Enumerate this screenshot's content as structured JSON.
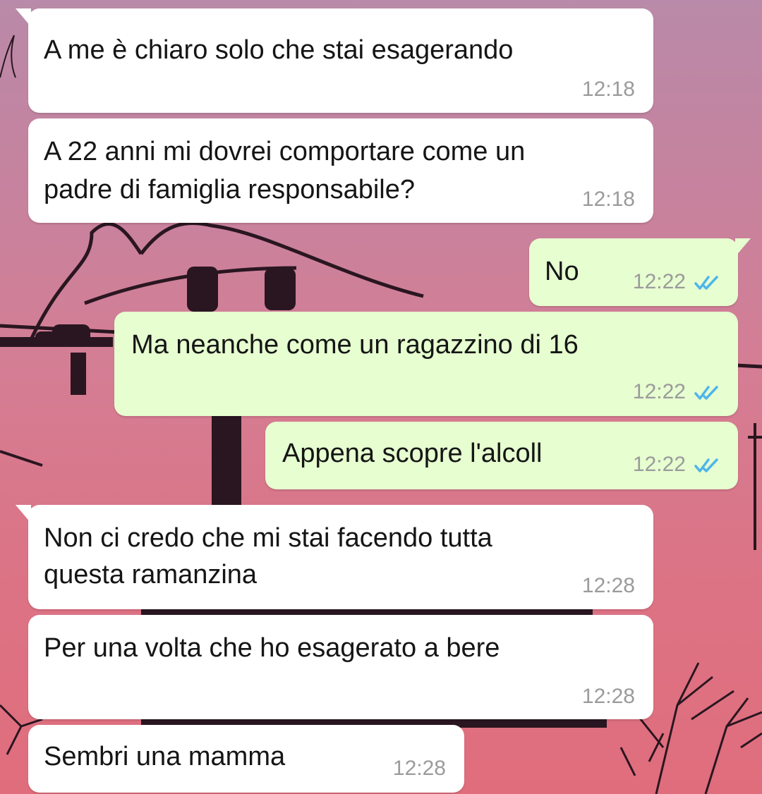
{
  "chat": {
    "messages": [
      {
        "dir": "in",
        "text": "A me è chiaro solo che stai esagerando",
        "time": "12:18"
      },
      {
        "dir": "in",
        "text_lines": [
          "A 22 anni mi dovrei comportare come un",
          "padre di famiglia responsabile?"
        ],
        "time": "12:18"
      },
      {
        "dir": "out",
        "text": "No",
        "time": "12:22",
        "status": "read"
      },
      {
        "dir": "out",
        "text": "Ma neanche come un ragazzino di 16",
        "time": "12:22",
        "status": "read"
      },
      {
        "dir": "out",
        "text": "Appena scopre l'alcoll",
        "time": "12:22",
        "status": "read"
      },
      {
        "dir": "in",
        "text_lines": [
          "Non ci credo che mi stai facendo tutta",
          "questa ramanzina"
        ],
        "time": "12:28"
      },
      {
        "dir": "in",
        "text": "Per una volta che ho esagerato a bere",
        "time": "12:28"
      },
      {
        "dir": "in",
        "text": "Sembri una mamma",
        "time": "12:28"
      }
    ]
  },
  "colors": {
    "incoming_bubble": "#ffffff",
    "outgoing_bubble": "#e6fed0",
    "read_ticks": "#4fb5ec",
    "timestamp": "#9b9b9b"
  },
  "icons": {
    "read_status": "double-check-icon",
    "background": "power-pole-sunset-wallpaper"
  }
}
